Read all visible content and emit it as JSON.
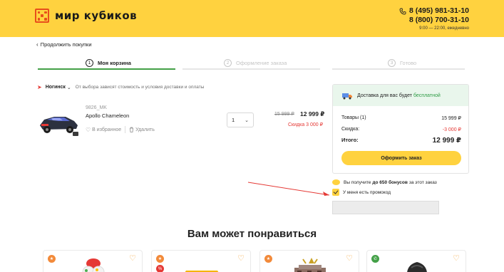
{
  "header": {
    "logo_text": "мир кубиков",
    "phone1": "8 (495) 981-31-10",
    "phone2": "8 (800) 700-31-10",
    "hours": "9:00 — 22:00, ежедневно"
  },
  "nav": {
    "back_label": "Продолжить покупки"
  },
  "steps": [
    {
      "num": "1",
      "label": "Моя корзина"
    },
    {
      "num": "2",
      "label": "Оформление заказа"
    },
    {
      "num": "3",
      "label": "Готово"
    }
  ],
  "location": {
    "city": "Ногинск",
    "note": "От выбора зависят стоимость и условия доставки и оплаты"
  },
  "cart_item": {
    "sku": "9826_MK",
    "name": "Apollo Chameleon",
    "favorite_label": "В избранное",
    "delete_label": "Удалить",
    "quantity": "1",
    "price_old": "15 999 ₽",
    "price_new": "12 999 ₽",
    "discount": "Скидка 3 000 ₽"
  },
  "summary": {
    "delivery_text": "Доставка для вас будет",
    "delivery_free": "бесплатной",
    "goods_label": "Товары (1)",
    "goods_value": "15 999 ₽",
    "discount_label": "Скидка:",
    "discount_value": "-3 000 ₽",
    "total_label": "Итого:",
    "total_value": "12 999 ₽",
    "order_button": "Оформить заказ"
  },
  "bonus": {
    "prefix": "Вы получите",
    "amount": "до 650 бонусов",
    "suffix": "за этот заказ"
  },
  "promo": {
    "checkbox_label": "У меня есть промокод",
    "placeholder": ""
  },
  "recommend": {
    "title": "Вам может понравиться"
  },
  "colors": {
    "brand_yellow": "#ffd23f",
    "brand_red": "#e84e1b",
    "accent_green": "#43a047",
    "discount_red": "#e53935"
  }
}
